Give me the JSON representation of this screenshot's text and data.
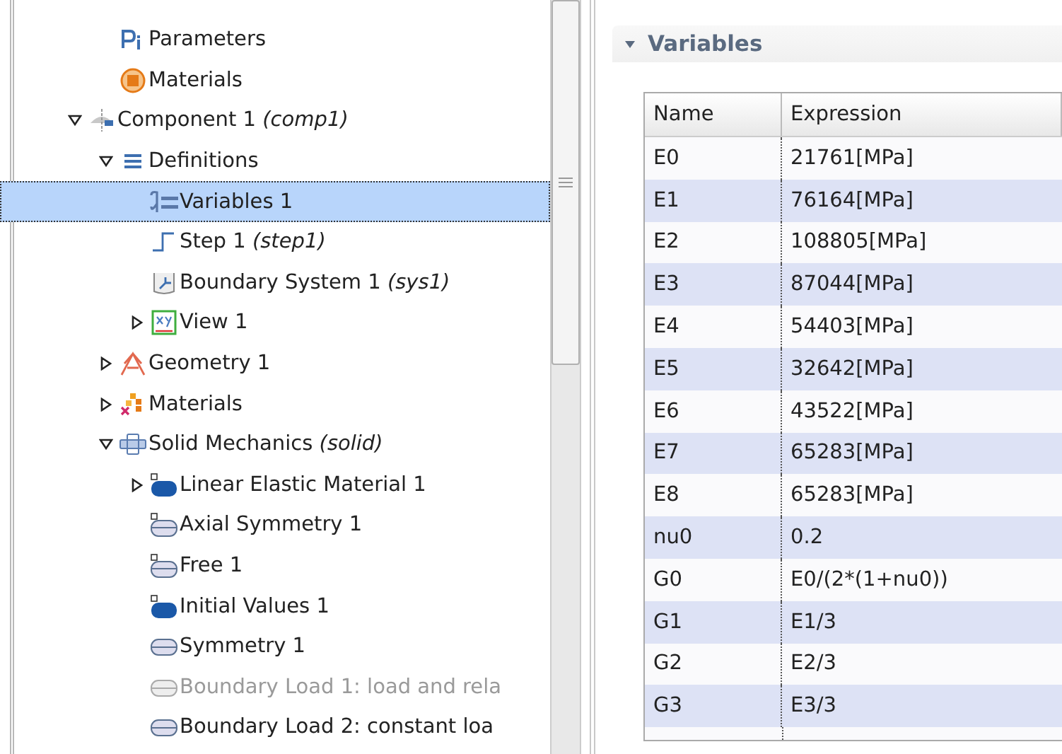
{
  "tree": {
    "global_items": [
      {
        "label": "Parameters",
        "kind": "parameters",
        "selected": false,
        "disabled": false
      },
      {
        "label": "Materials",
        "kind": "materials-global",
        "selected": false,
        "disabled": false
      }
    ],
    "items": [
      {
        "label": "Component 1",
        "tag": "(comp1)",
        "kind": "component",
        "expanded": true,
        "selected": false,
        "disabled": false,
        "children": [
          {
            "label": "Definitions",
            "kind": "definitions",
            "expanded": true,
            "selected": false,
            "disabled": false,
            "children": [
              {
                "label": "Variables 1",
                "kind": "variables",
                "selected": true,
                "disabled": false
              },
              {
                "label": "Step 1",
                "tag": "(step1)",
                "kind": "step",
                "selected": false,
                "disabled": false
              },
              {
                "label": "Boundary System 1",
                "tag": "(sys1)",
                "kind": "system",
                "selected": false,
                "disabled": false
              },
              {
                "label": "View 1",
                "kind": "view",
                "expanded": false,
                "selected": false,
                "disabled": false
              }
            ]
          },
          {
            "label": "Geometry 1",
            "kind": "geometry",
            "expanded": false,
            "selected": false,
            "disabled": false
          },
          {
            "label": "Materials",
            "kind": "materials",
            "expanded": false,
            "selected": false,
            "disabled": false
          },
          {
            "label": "Solid Mechanics",
            "tag": "(solid)",
            "kind": "physics",
            "expanded": true,
            "selected": false,
            "disabled": false,
            "children": [
              {
                "label": "Linear Elastic Material 1",
                "kind": "domain-filled",
                "expanded": false,
                "selected": false,
                "disabled": false
              },
              {
                "label": "Axial Symmetry 1",
                "kind": "domain",
                "selected": false,
                "disabled": false
              },
              {
                "label": "Free 1",
                "kind": "domain",
                "selected": false,
                "disabled": false
              },
              {
                "label": "Initial Values 1",
                "kind": "domain-filled",
                "selected": false,
                "disabled": false
              },
              {
                "label": "Symmetry 1",
                "kind": "boundary",
                "selected": false,
                "disabled": false
              },
              {
                "label": "Boundary Load 1: load and rela",
                "kind": "boundary",
                "selected": false,
                "disabled": true
              },
              {
                "label": "Boundary Load 2: constant loa",
                "kind": "boundary",
                "selected": false,
                "disabled": false
              }
            ]
          }
        ]
      }
    ]
  },
  "section": {
    "title": "Variables",
    "expanded": true
  },
  "table": {
    "columns": [
      "Name",
      "Expression"
    ],
    "rows": [
      [
        "E0",
        "21761[MPa]"
      ],
      [
        "E1",
        "76164[MPa]"
      ],
      [
        "E2",
        "108805[MPa]"
      ],
      [
        "E3",
        "87044[MPa]"
      ],
      [
        "E4",
        "54403[MPa]"
      ],
      [
        "E5",
        "32642[MPa]"
      ],
      [
        "E6",
        "43522[MPa]"
      ],
      [
        "E7",
        "65283[MPa]"
      ],
      [
        "E8",
        "65283[MPa]"
      ],
      [
        "nu0",
        "0.2"
      ],
      [
        "G0",
        "E0/(2*(1+nu0))"
      ],
      [
        "G1",
        "E1/3"
      ],
      [
        "G2",
        "E2/3"
      ],
      [
        "G3",
        "E3/3"
      ]
    ]
  }
}
